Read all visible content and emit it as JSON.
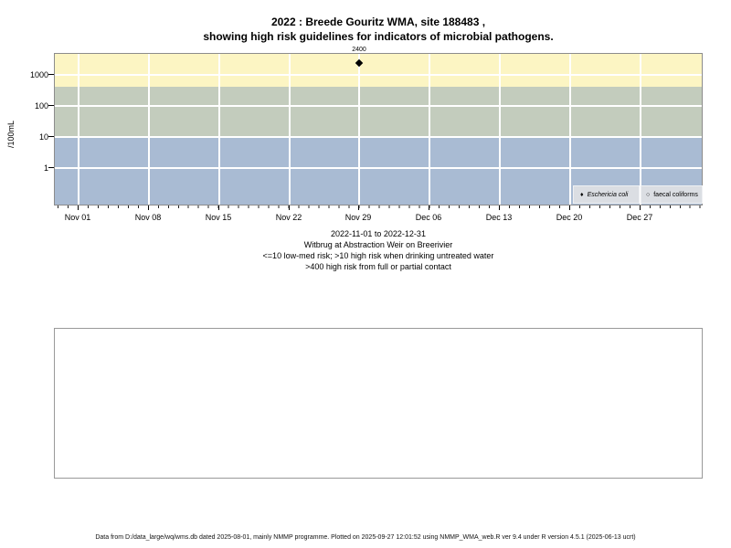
{
  "title": {
    "line1": "2022 : Breede Gouritz WMA, site 188483 ,",
    "line2": "showing high risk guidelines for indicators of microbial pathogens."
  },
  "chart_data": {
    "type": "scatter",
    "title": "2022 : Breede Gouritz WMA, site 188483 , showing high risk guidelines for indicators of microbial pathogens.",
    "ylabel": "/100mL",
    "y_scale": "log",
    "ylim": [
      0.06,
      4700
    ],
    "y_ticks": [
      "1000",
      "100",
      "10",
      "1"
    ],
    "x_ticks": [
      "Nov 01",
      "Nov 08",
      "Nov 15",
      "Nov 22",
      "Nov 29",
      "Dec 06",
      "Dec 13",
      "Dec 20",
      "Dec 27"
    ],
    "x_range": "2022-11-01 to 2022-12-31",
    "grid": "white major gridlines on",
    "legend_position": "bottom-right inside plot",
    "risk_bands": [
      {
        "name": "high risk",
        "rule": ">400",
        "color": "#FCF5C3"
      },
      {
        "name": "medium risk",
        "rule": ">10 to 400",
        "color": "#C3CCBD"
      },
      {
        "name": "low-med risk",
        "rule": "<=10",
        "color": "#A9BBD3"
      }
    ],
    "series": [
      {
        "name": "Eschericia coli",
        "symbol": "filled-diamond",
        "points": [
          {
            "date": "2022-11-29",
            "value": 2400,
            "label": "2400"
          }
        ]
      },
      {
        "name": "faecal coliforms",
        "symbol": "open-circle",
        "points": []
      }
    ],
    "legend": [
      {
        "symbol": "♦",
        "label": "Eschericia coli"
      },
      {
        "symbol": "○",
        "label": "faecal coliforms"
      }
    ]
  },
  "caption": {
    "line1": "2022-11-01 to 2022-12-31",
    "line2": "Witbrug at Abstraction Weir on Breerivier",
    "line3": "<=10 low-med risk; >10 high risk when drinking untreated water",
    "line4": ">400 high risk from full or partial contact"
  },
  "footer": "Data from D:/data_large/wq/wms.db dated 2025-08-01, mainly NMMP programme. Plotted on 2025-09-27 12:01:52 using NMMP_WMA_web.R ver 9.4 under R version 4.5.1 (2025-06-13 ucrt)"
}
